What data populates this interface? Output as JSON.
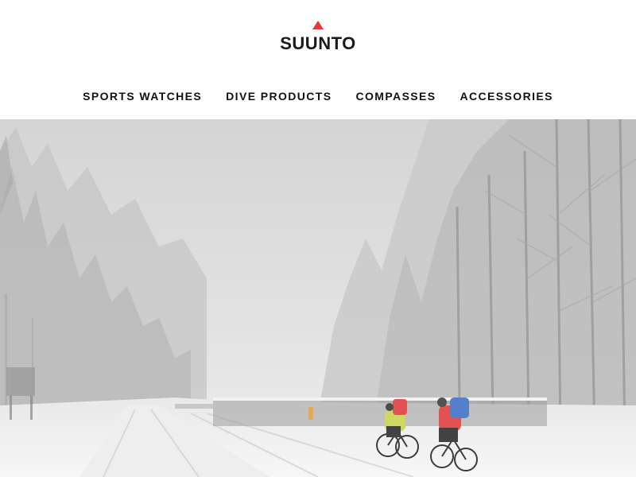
{
  "brand": {
    "logo_text": "SUUNTO",
    "logo_accent_color": "#e2383f",
    "logo_icon": "red-triangle-icon"
  },
  "nav": {
    "items": [
      {
        "label": "SPORTS WATCHES"
      },
      {
        "label": "DIVE PRODUCTS"
      },
      {
        "label": "COMPASSES"
      },
      {
        "label": "ACCESSORIES"
      }
    ]
  },
  "hero": {
    "image_subject": "snowy-forest-road-cyclists",
    "sky_color": "#d8d8d8",
    "snow_color": "#f4f4f4",
    "jacket_colors": [
      "#c8d34a",
      "#e03b3b",
      "#3d6fc4"
    ]
  }
}
